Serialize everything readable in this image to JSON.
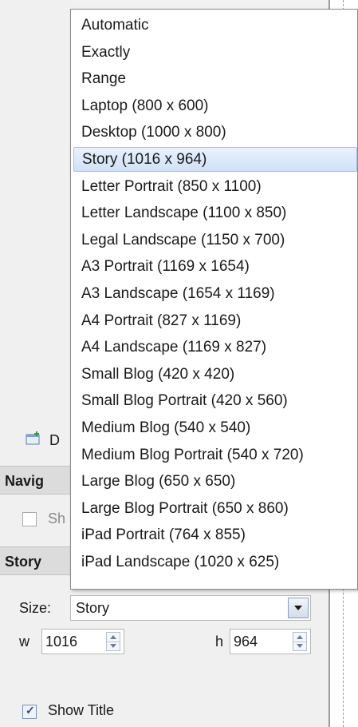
{
  "dropdown": {
    "selected_index": 5,
    "items": [
      "Automatic",
      "Exactly",
      "Range",
      "Laptop (800 x 600)",
      "Desktop (1000 x 800)",
      "Story (1016 x 964)",
      "Letter Portrait (850 x 1100)",
      "Letter Landscape (1100 x 850)",
      "Legal Landscape (1150 x 700)",
      "A3 Portrait (1169 x 1654)",
      "A3 Landscape (1654 x 1169)",
      "A4 Portrait (827 x 1169)",
      "A4 Landscape (1169 x 827)",
      "Small Blog (420 x 420)",
      "Small Blog Portrait (420 x 560)",
      "Medium Blog (540 x 540)",
      "Medium Blog Portrait (540 x 720)",
      "Large Blog (650 x 650)",
      "Large Blog Portrait (650 x 860)",
      "iPad Portrait (764 x 855)",
      "iPad Landscape (1020 x 625)"
    ]
  },
  "panel": {
    "dashboard_row_partial": "D",
    "navigator_header_partial": "Navig",
    "navigator_checkbox_partial": "Sh",
    "story_header_partial": "Story",
    "size_label": "Size:",
    "size_value": "Story",
    "w_label": "w",
    "w_value": "1016",
    "h_label": "h",
    "h_value": "964",
    "show_title_label": "Show Title",
    "show_title_checked": true
  },
  "colors": {
    "selection_fill": "#cfe1f8",
    "selection_border": "#9fc1ea",
    "panel_bg": "#f0f0f0",
    "header_bg": "#dcdcdc"
  }
}
